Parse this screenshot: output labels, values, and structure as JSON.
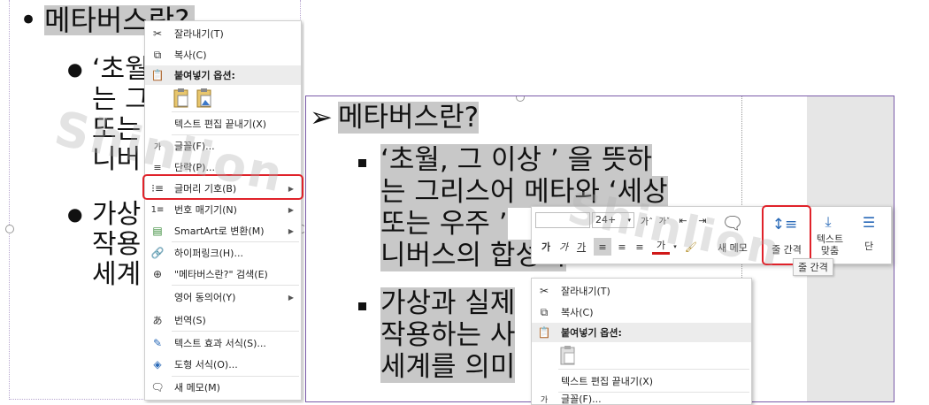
{
  "left": {
    "heading": "메타버스란?",
    "bullet1_lines": [
      "‘초월",
      "는 그",
      "또는",
      "니버"
    ],
    "bullet2_lines": [
      "가상",
      "작용",
      "세계"
    ],
    "menu": {
      "cut": "잘라내기(T)",
      "copy": "복사(C)",
      "paste_options": "붙여넣기 옵션:",
      "exit_text_edit": "텍스트 편집 끝내기(X)",
      "font": "글꼴(F)...",
      "paragraph": "단락(P)...",
      "bullets": "글머리 기호(B)",
      "numbering": "번호 매기기(N)",
      "smartart": "SmartArt로 변환(M)",
      "hyperlink": "하이퍼링크(H)...",
      "search": "\"메타버스란?\" 검색(E)",
      "synonyms": "영어 동의어(Y)",
      "translate": "번역(S)",
      "text_effects": "텍스트 효과 서식(S)...",
      "shape_format": "도형 서식(O)...",
      "new_memo": "새 메모(M)"
    }
  },
  "right": {
    "heading": "메타버스란?",
    "bullet1_lines": [
      "‘초월, 그 이상 ’ 을 뜻하",
      "는 그리스어 메타와 ‘세상",
      "또는 우주 ’",
      "니버스의 합성어"
    ],
    "bullet2_lines": [
      "가상과 실제",
      "작용하는 사",
      "세계를 의미"
    ],
    "toolbar": {
      "font_name": "",
      "font_size": "24+",
      "bold": "가",
      "italic": "가",
      "underline": "가",
      "font_color_glyph": "가",
      "new_memo": "새 메모",
      "line_spacing": "줄 간격",
      "text_fit_1": "텍스트",
      "text_fit_2": "맞춤",
      "column": "단"
    },
    "tooltip": "줄 간격",
    "menu": {
      "cut": "잘라내기(T)",
      "copy": "복사(C)",
      "paste_options": "붙여넣기 옵션:",
      "exit_text_edit": "텍스트 편집 끝내기(X)",
      "font": "글꼴(F)..."
    }
  },
  "watermark": "Shinlion",
  "colors": {
    "highlight_box": "#e0222a",
    "selection": "#c8c8c8",
    "frame": "#7a5aa8"
  }
}
